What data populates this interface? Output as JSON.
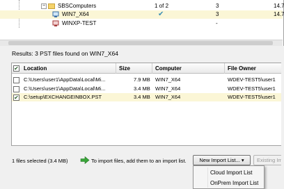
{
  "tree": {
    "rows": [
      {
        "name": "SBSComputers",
        "c1": "1 of 2",
        "c2": "3",
        "c3": "14.7",
        "expander": "−"
      },
      {
        "name": "WIN7_X64",
        "c1": "",
        "c2": "3",
        "c3": "14.7",
        "checked": "✔"
      },
      {
        "name": "WINXP-TEST",
        "c1": "",
        "c2": "-",
        "c3": ""
      }
    ]
  },
  "results": {
    "summary": "Results: 3 PST files found on WIN7_X64",
    "columns": [
      "Location",
      "Size",
      "Computer",
      "File Owner"
    ],
    "header_check": "✔",
    "rows": [
      {
        "check": "",
        "location": "C:\\Users\\user1\\AppData\\Local\\Mi...",
        "size": "7.9 MB",
        "computer": "WIN7_X64",
        "owner": "WDEV-TEST5\\user1"
      },
      {
        "check": "",
        "location": "C:\\Users\\user1\\AppData\\Local\\Mi...",
        "size": "3.4 MB",
        "computer": "WIN7_X64",
        "owner": "WDEV-TEST5\\user1"
      },
      {
        "check": "✔",
        "location": "C:\\setup\\EXCHANGEINBOX.PST",
        "size": "3.4 MB",
        "computer": "WIN7_X64",
        "owner": "WDEV-TEST5\\user1"
      }
    ]
  },
  "footer": {
    "selected": "1 files selected (3.4 MB)",
    "hint": "To import files, add them to an import list.",
    "new_list_button": "New Import List...",
    "new_list_arrow": "▾",
    "existing_button": "Existing Im"
  },
  "menu": {
    "items": [
      "Cloud Import List",
      "OnPrem Import List"
    ]
  },
  "colors": {
    "selected_row": "#fbf6d6",
    "check_blue": "#3b8fb4",
    "arrow_green": "#3aa53a"
  }
}
